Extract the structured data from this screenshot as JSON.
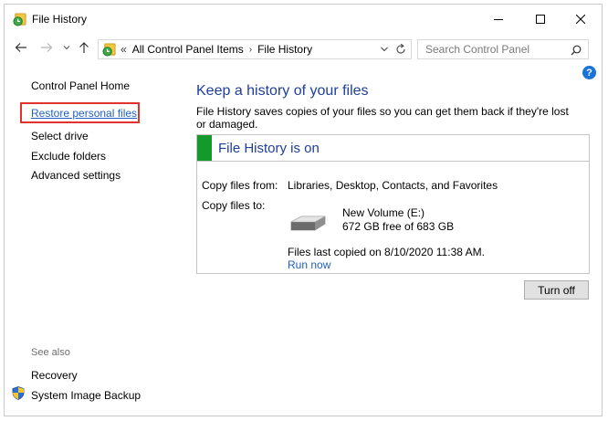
{
  "window": {
    "title": "File History",
    "controls": [
      "minimize",
      "maximize",
      "close"
    ]
  },
  "address_bar": {
    "overflow_glyph": "«",
    "breadcrumbs": [
      "All Control Panel Items",
      "File History"
    ],
    "separator": "›"
  },
  "search": {
    "placeholder": "Search Control Panel"
  },
  "left_pane": {
    "home": "Control Panel Home",
    "links": [
      "Restore personal files",
      "Select drive",
      "Exclude folders",
      "Advanced settings"
    ],
    "see_also_label": "See also",
    "see_also": [
      "Recovery",
      "System Image Backup"
    ]
  },
  "main": {
    "heading": "Keep a history of your files",
    "description": "File History saves copies of your files so you can get them back if they're lost or damaged.",
    "status": "File History is on",
    "copy_from_label": "Copy files from:",
    "copy_from_value": "Libraries, Desktop, Contacts, and Favorites",
    "copy_to_label": "Copy files to:",
    "drive_name": "New Volume (E:)",
    "drive_space": "672 GB free of 683 GB",
    "last_copied": "Files last copied on 8/10/2020 11:38 AM.",
    "run_now": "Run now",
    "turn_off": "Turn off"
  },
  "colors": {
    "status_green": "#149a2c",
    "heading_blue": "#1e3f9a",
    "link_blue": "#1f5fbf",
    "highlight_red": "#e0332c",
    "help_blue": "#1a73d9"
  },
  "icons": [
    "file-history-icon",
    "back-arrow-icon",
    "forward-arrow-icon",
    "recent-dropdown-icon",
    "up-arrow-icon",
    "chevron-down-icon",
    "refresh-icon",
    "search-icon",
    "help-icon",
    "drive-icon",
    "shield-icon"
  ]
}
